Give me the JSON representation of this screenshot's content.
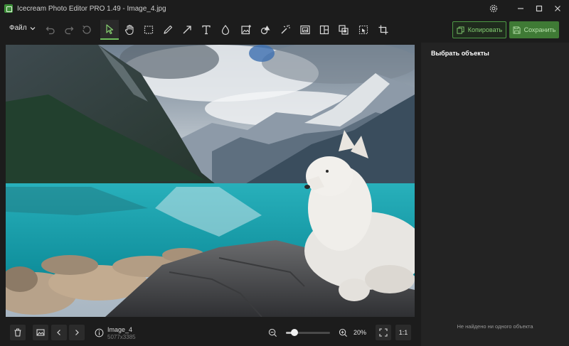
{
  "window": {
    "title": "Icecream Photo Editor PRO 1.49 - Image_4.jpg"
  },
  "toolbar": {
    "file_label": "Файл",
    "copy_label": "Копировать",
    "save_label": "Сохранить",
    "tools": [
      "undo-icon",
      "redo-icon",
      "reset-icon",
      "select-cursor-icon",
      "hand-icon",
      "marquee-icon",
      "brush-icon",
      "arrow-icon",
      "text-icon",
      "drop-icon",
      "image-plus-icon",
      "shapes-icon",
      "magic-wand-icon",
      "frame-icon",
      "split-icon",
      "layers-icon",
      "crop-select-icon",
      "crop-icon"
    ],
    "active_tool": "select-cursor-icon"
  },
  "panel": {
    "title": "Выбрать объекты",
    "empty_text": "Не найдено ни одного объекта"
  },
  "file": {
    "name": "Image_4",
    "size": "5077x3385"
  },
  "zoom": {
    "percent_label": "20%",
    "level": 0.2,
    "one_to_one_label": "1:1"
  },
  "colors": {
    "accent": "#6fbf5c",
    "save_button": "#3f7a35",
    "background": "#1c1c1c",
    "panel": "#232323"
  }
}
